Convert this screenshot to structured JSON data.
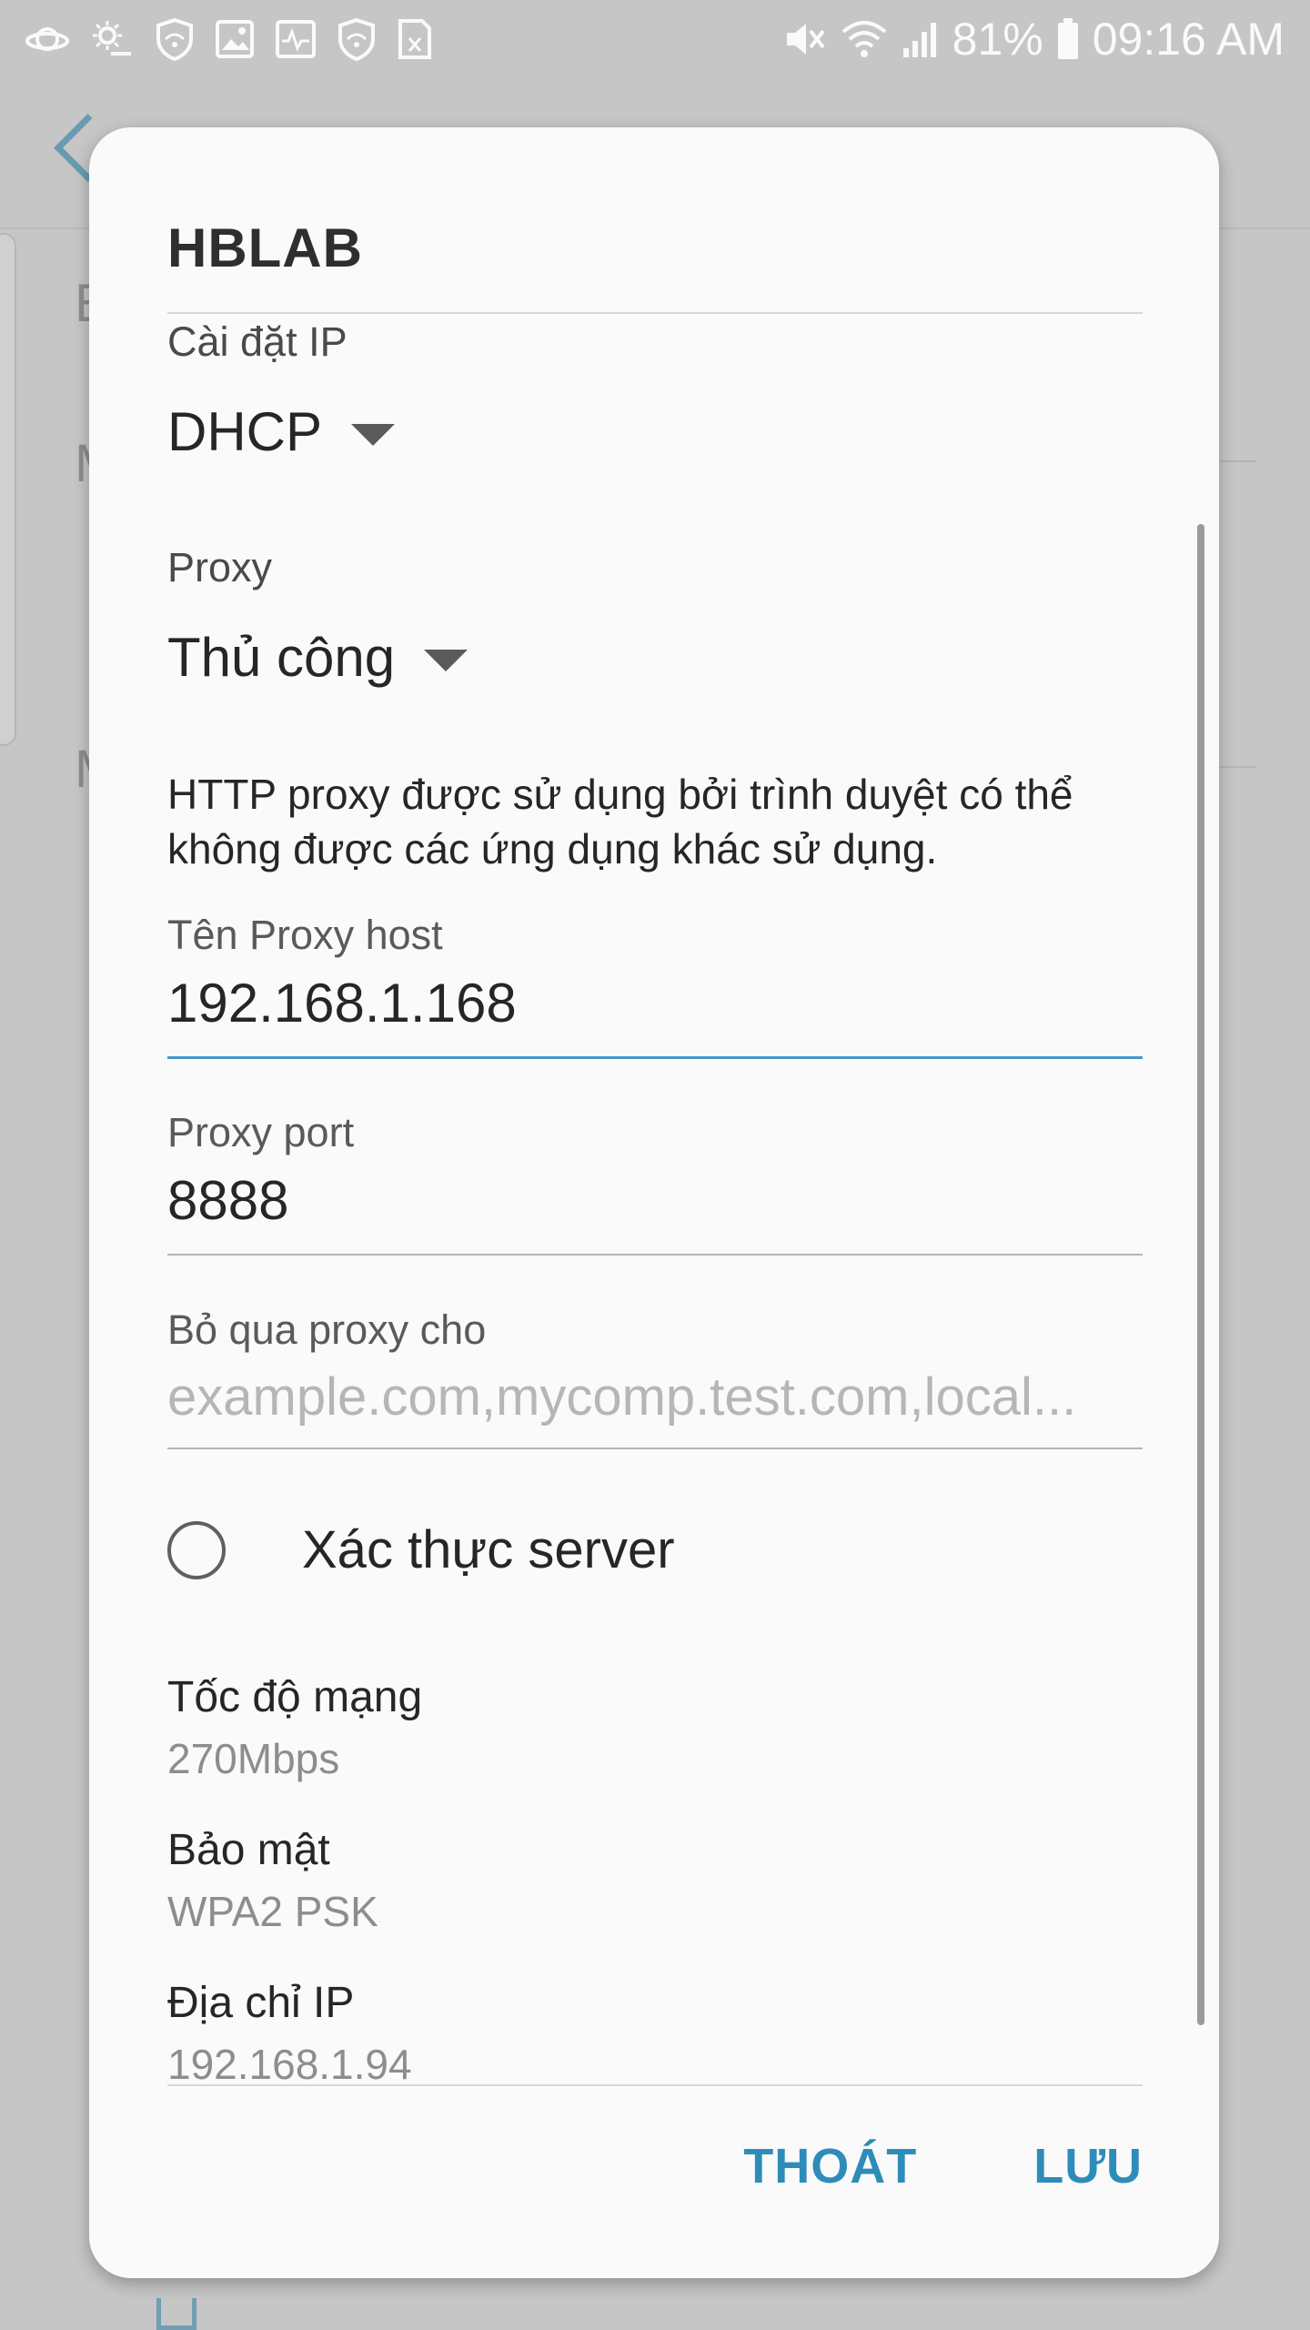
{
  "status_bar": {
    "icons_left": [
      "saturn-icon",
      "weather-icon",
      "shield-icon",
      "image-icon",
      "activity-icon",
      "shield-icon",
      "card-icon"
    ],
    "icons_right": [
      "mute-icon",
      "wifi-icon",
      "signal-icon",
      "battery-icon"
    ],
    "battery": "81%",
    "time": "09:16 AM"
  },
  "background": {
    "letters": [
      "E",
      "M",
      "M"
    ]
  },
  "dialog": {
    "title": "HBLAB",
    "ip_settings": {
      "label": "Cài đặt IP",
      "value": "DHCP"
    },
    "proxy": {
      "label": "Proxy",
      "value": "Thủ công"
    },
    "proxy_description": "HTTP proxy được sử dụng bởi trình duyệt có thể không được các ứng dụng khác sử dụng.",
    "proxy_host": {
      "label": "Tên Proxy host",
      "value": "192.168.1.168"
    },
    "proxy_port": {
      "label": "Proxy port",
      "value": "8888"
    },
    "bypass": {
      "label": "Bỏ qua proxy cho",
      "placeholder": "example.com,mycomp.test.com,local..."
    },
    "server_auth": {
      "label": "Xác thực server",
      "checked": false
    },
    "network_speed": {
      "label": "Tốc độ mạng",
      "value": "270Mbps"
    },
    "security": {
      "label": "Bảo mật",
      "value": "WPA2 PSK"
    },
    "ip_address": {
      "label": "Địa chỉ IP",
      "value": "192.168.1.94"
    },
    "buttons": {
      "cancel": "THOÁT",
      "save": "LƯU"
    }
  },
  "colors": {
    "accent": "#2e8db8",
    "focus_underline": "#3f9bc9",
    "dialog_bg": "#fafafa",
    "scrim": "#c6c6c6"
  }
}
